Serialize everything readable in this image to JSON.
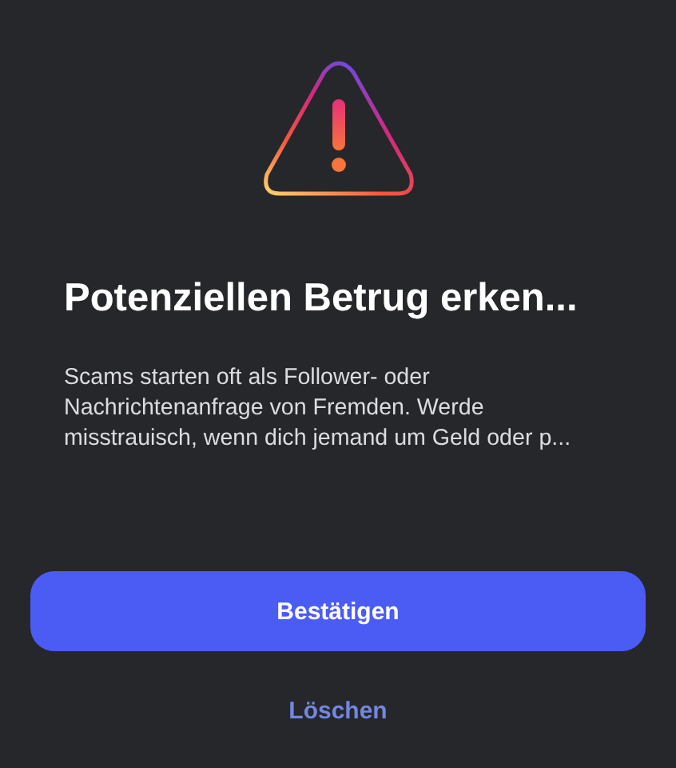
{
  "title": "Potenziellen Betrug erken...",
  "body": "Scams starten oft als Follower- oder Nachrichtenanfrage von Fremden. Werde misstrauisch, wenn dich jemand um Geld oder p...",
  "primary_button": "Bestätigen",
  "secondary_button": "Löschen"
}
